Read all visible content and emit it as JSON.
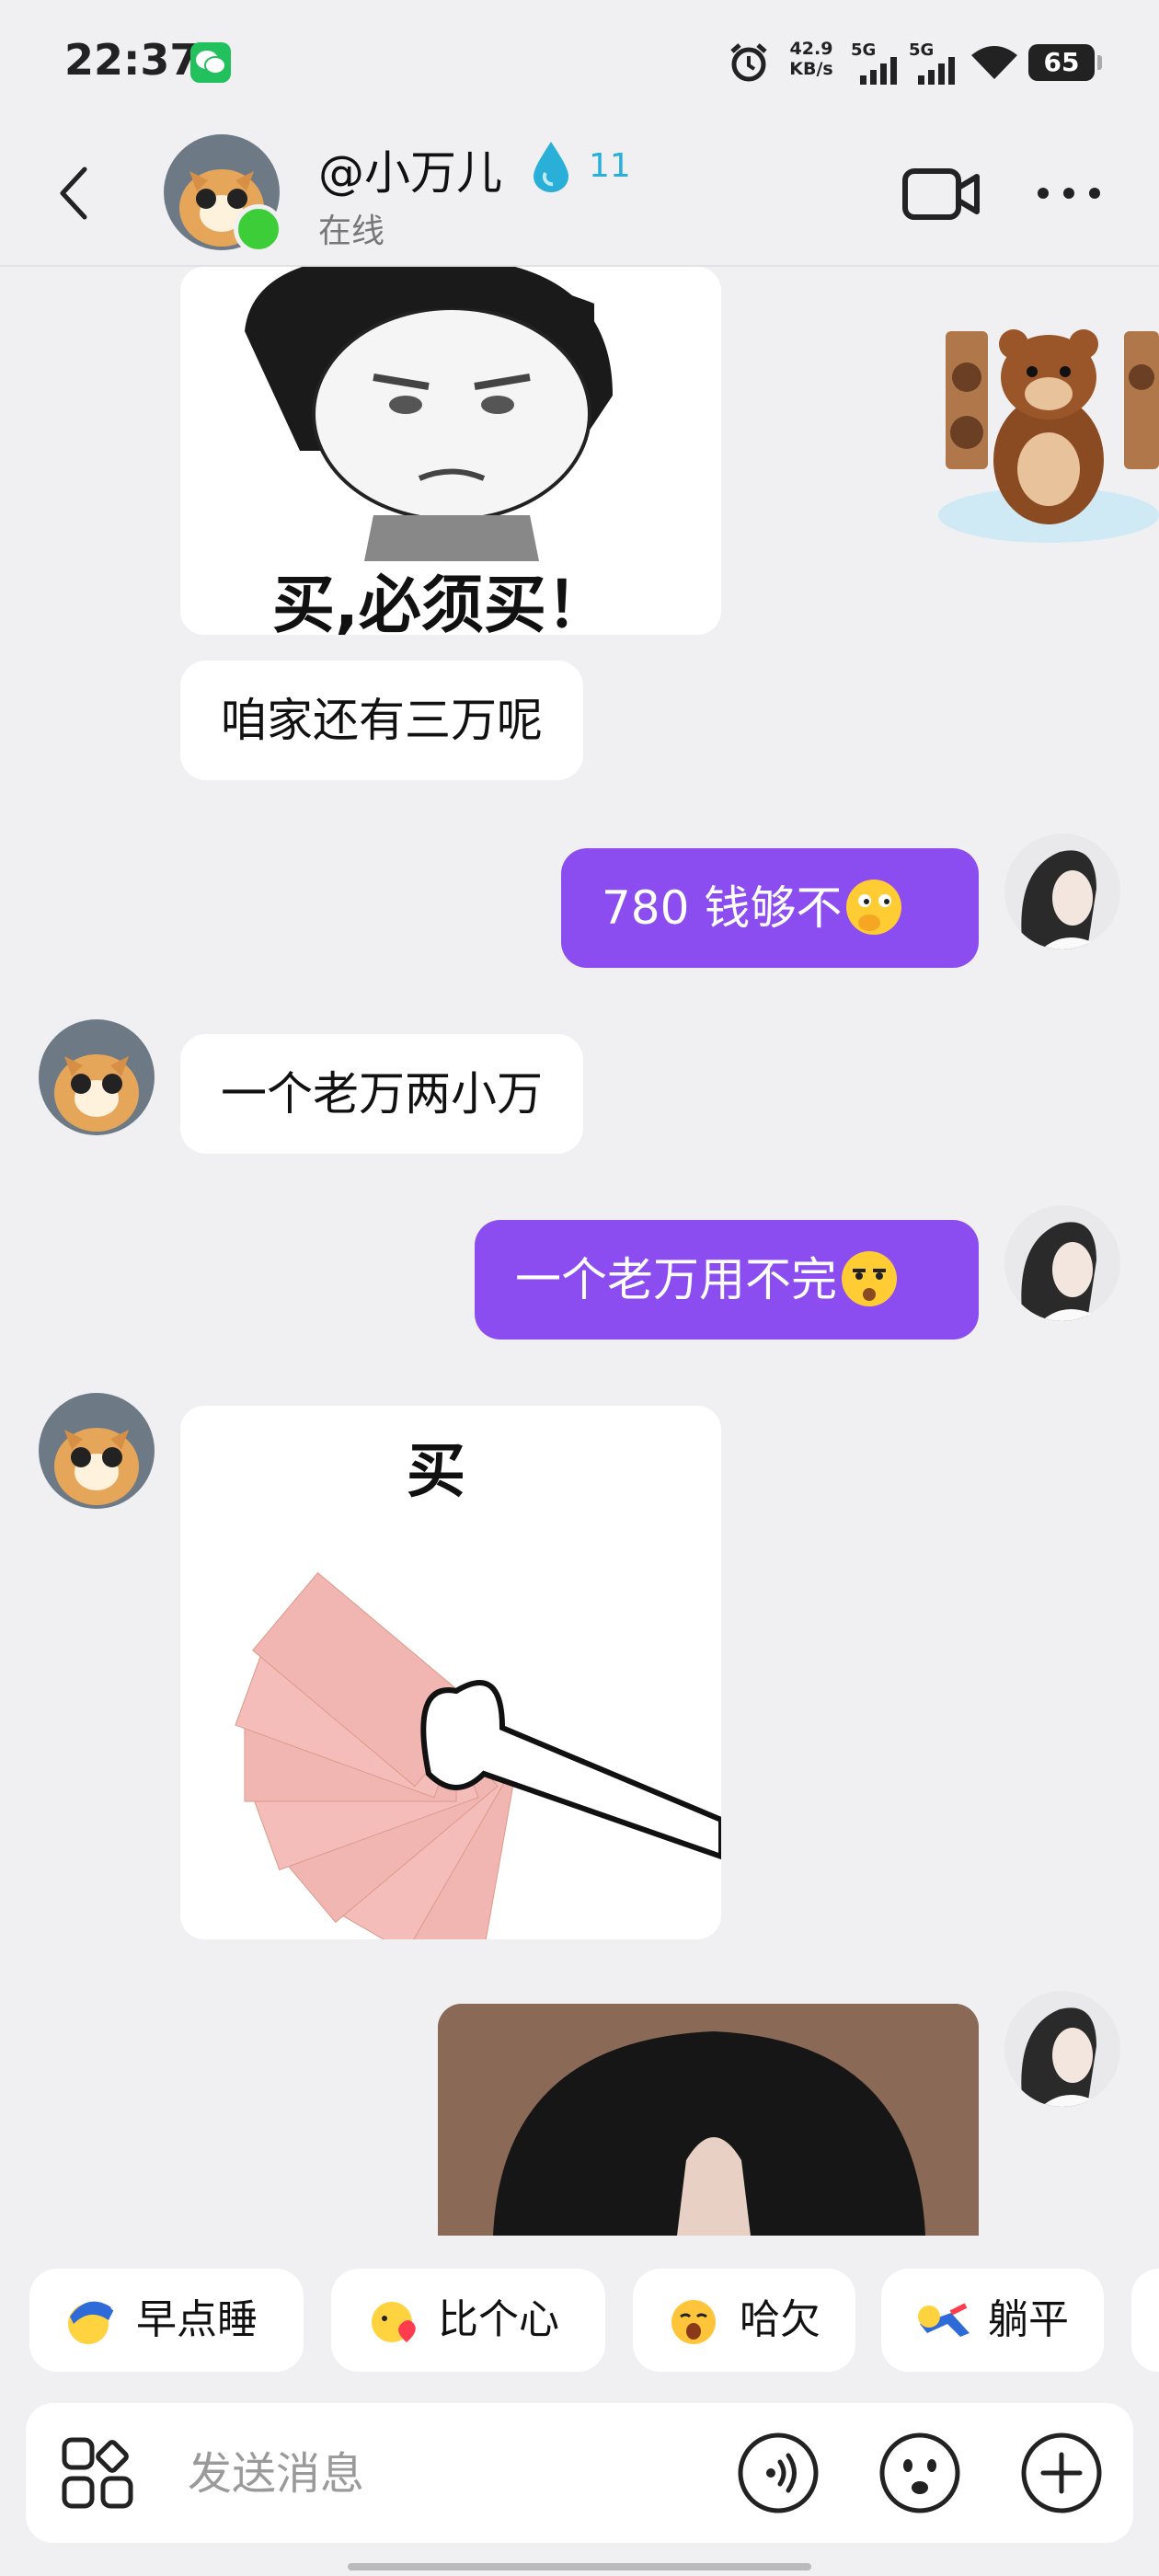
{
  "status_bar": {
    "time": "22:37",
    "net_speed_value": "42.9",
    "net_speed_unit": "KB/s",
    "signal_1": "5G",
    "signal_2": "5G",
    "battery": "65"
  },
  "header": {
    "contact_name": "@小万儿",
    "fire_count": "11",
    "status": "在线"
  },
  "messages": {
    "sticker_1_caption": "买,必须买！",
    "msg_1": "咱家还有三万呢",
    "msg_2": "780  钱够不",
    "msg_3": "一个老万两小万",
    "msg_4": "一个老万用不完",
    "sticker_2_caption": "买"
  },
  "quick_replies": [
    "早点睡",
    "比个心",
    "哈欠",
    "躺平"
  ],
  "composer": {
    "placeholder": "发送消息"
  },
  "colors": {
    "outgoing_bubble": "#8b4cf0",
    "online_dot": "#3ccd38",
    "fire": "#2ab0d8"
  }
}
